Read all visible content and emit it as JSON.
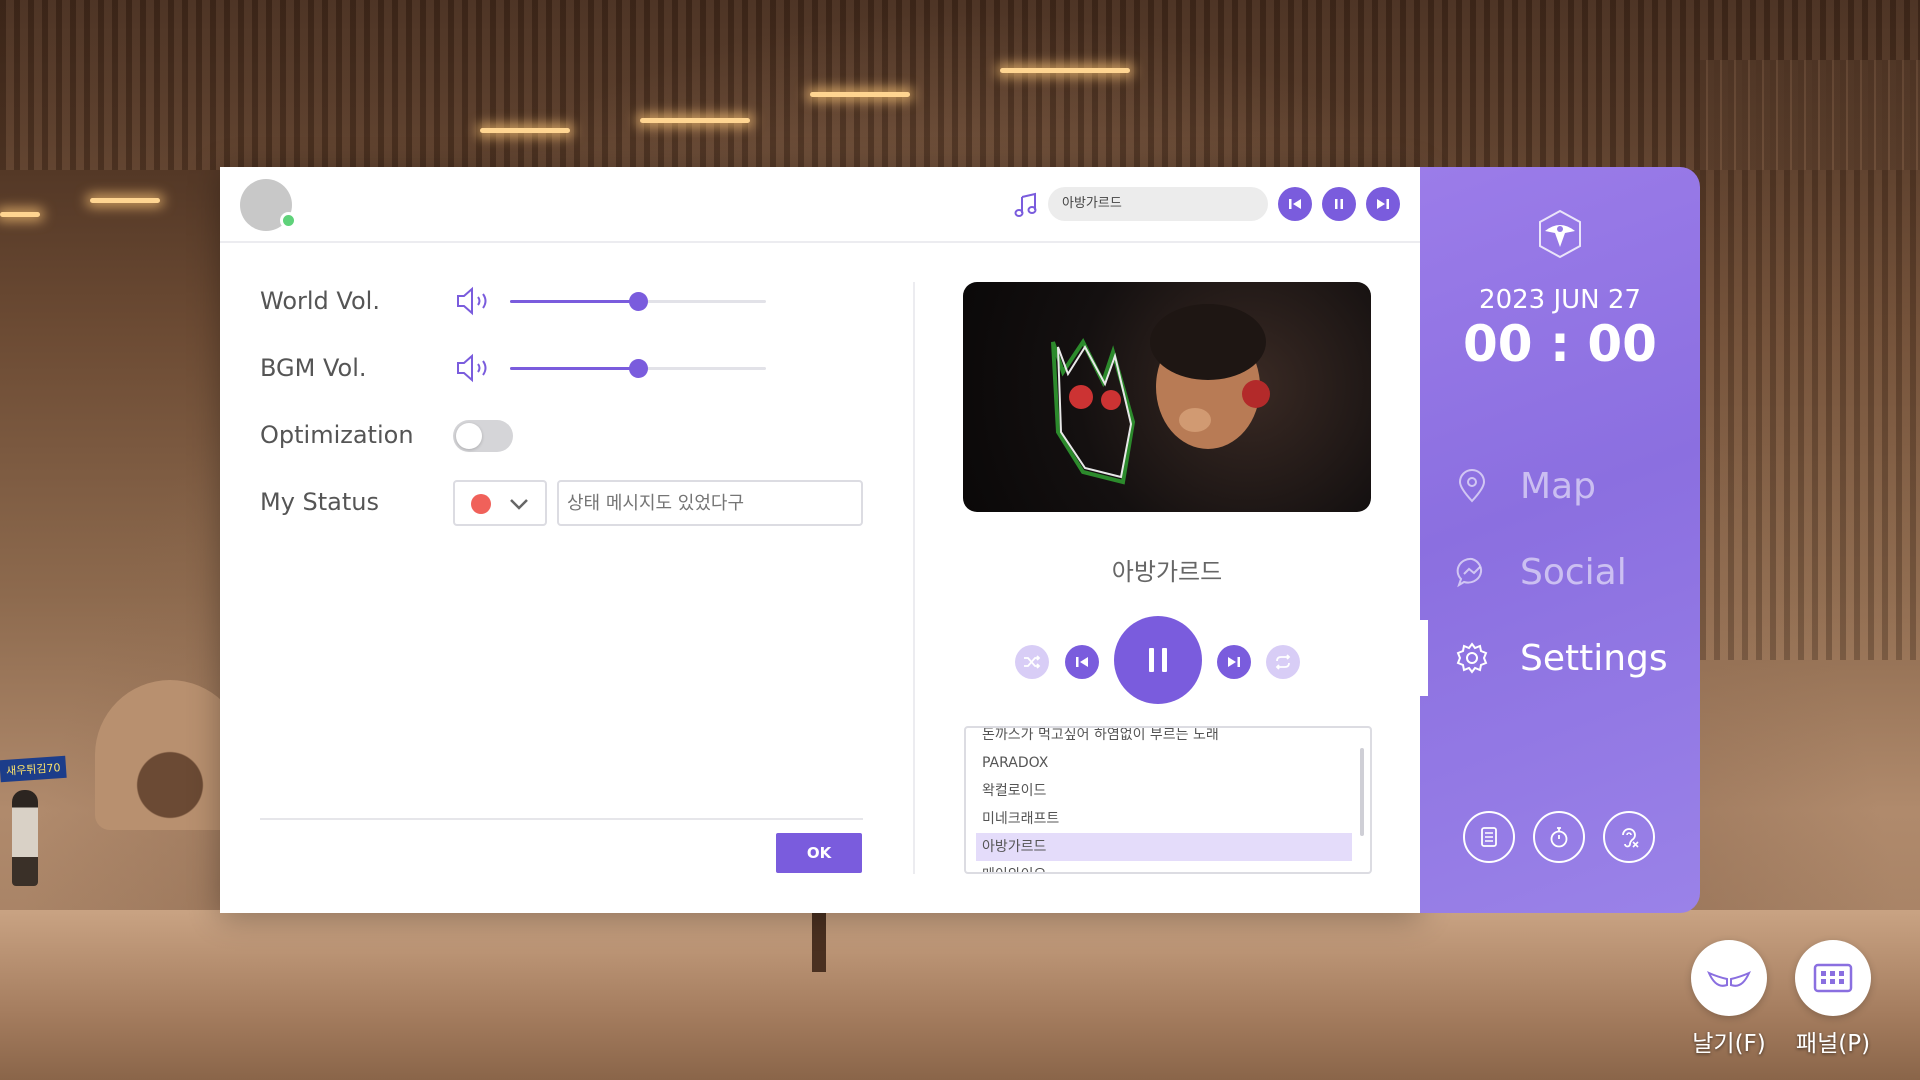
{
  "header": {
    "now_playing": "아방가르드"
  },
  "settings": {
    "world_vol": {
      "label": "World Vol.",
      "level": 0.5
    },
    "bgm_vol": {
      "label": "BGM Vol.",
      "level": 0.5
    },
    "optimization": {
      "label": "Optimization",
      "on": false
    },
    "my_status": {
      "label": "My Status",
      "status_color": "#f0615a",
      "message_placeholder": "상태 메시지도 있었다구"
    },
    "ok_label": "OK"
  },
  "player": {
    "track_title": "아방가르드",
    "playlist": [
      {
        "title": "돈까스가 먹고싶어 하염없이 부르는 노래",
        "active": false
      },
      {
        "title": "PARADOX",
        "active": false
      },
      {
        "title": "왁컬로이드",
        "active": false
      },
      {
        "title": "미네크래프트",
        "active": false
      },
      {
        "title": "아방가르드",
        "active": true
      },
      {
        "title": "메이와이오",
        "active": false
      }
    ]
  },
  "side": {
    "date": "2023 JUN 27",
    "time": "00 : 00",
    "menu": [
      {
        "label": "Map",
        "icon": "map-pin-icon",
        "active": false
      },
      {
        "label": "Social",
        "icon": "chat-icon",
        "active": false
      },
      {
        "label": "Settings",
        "icon": "gear-icon",
        "active": true
      }
    ]
  },
  "fabs": {
    "fly_label": "날기(F)",
    "panel_label": "패널(P)"
  },
  "colors": {
    "accent": "#7a5cdd",
    "side_bg": "#9478e6",
    "online": "#5fd27a"
  }
}
